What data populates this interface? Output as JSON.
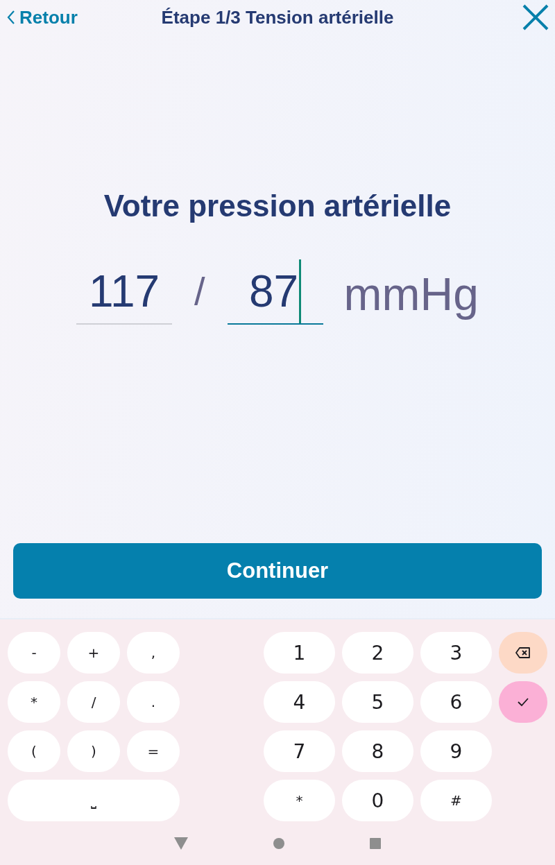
{
  "header": {
    "back": "Retour",
    "title": "Étape 1/3 Tension artérielle"
  },
  "heading": "Votre pression artérielle",
  "reading": {
    "fields": [
      {
        "value": "117",
        "focused": false
      },
      {
        "value": "87",
        "focused": true
      }
    ],
    "separator": "/",
    "unit": "mmHg"
  },
  "button": "Continuer",
  "keyboard": {
    "symbol_rows": [
      [
        "-",
        "+",
        ","
      ],
      [
        "*",
        "/",
        "."
      ],
      [
        "(",
        ")",
        "="
      ]
    ],
    "space_key": "⎵",
    "number_rows": [
      [
        "1",
        "2",
        "3"
      ],
      [
        "4",
        "5",
        "6"
      ],
      [
        "7",
        "8",
        "9"
      ],
      [
        "*",
        "0",
        "#"
      ]
    ],
    "action_keys": [
      {
        "kind": "backspace"
      },
      {
        "kind": "enter"
      }
    ]
  }
}
